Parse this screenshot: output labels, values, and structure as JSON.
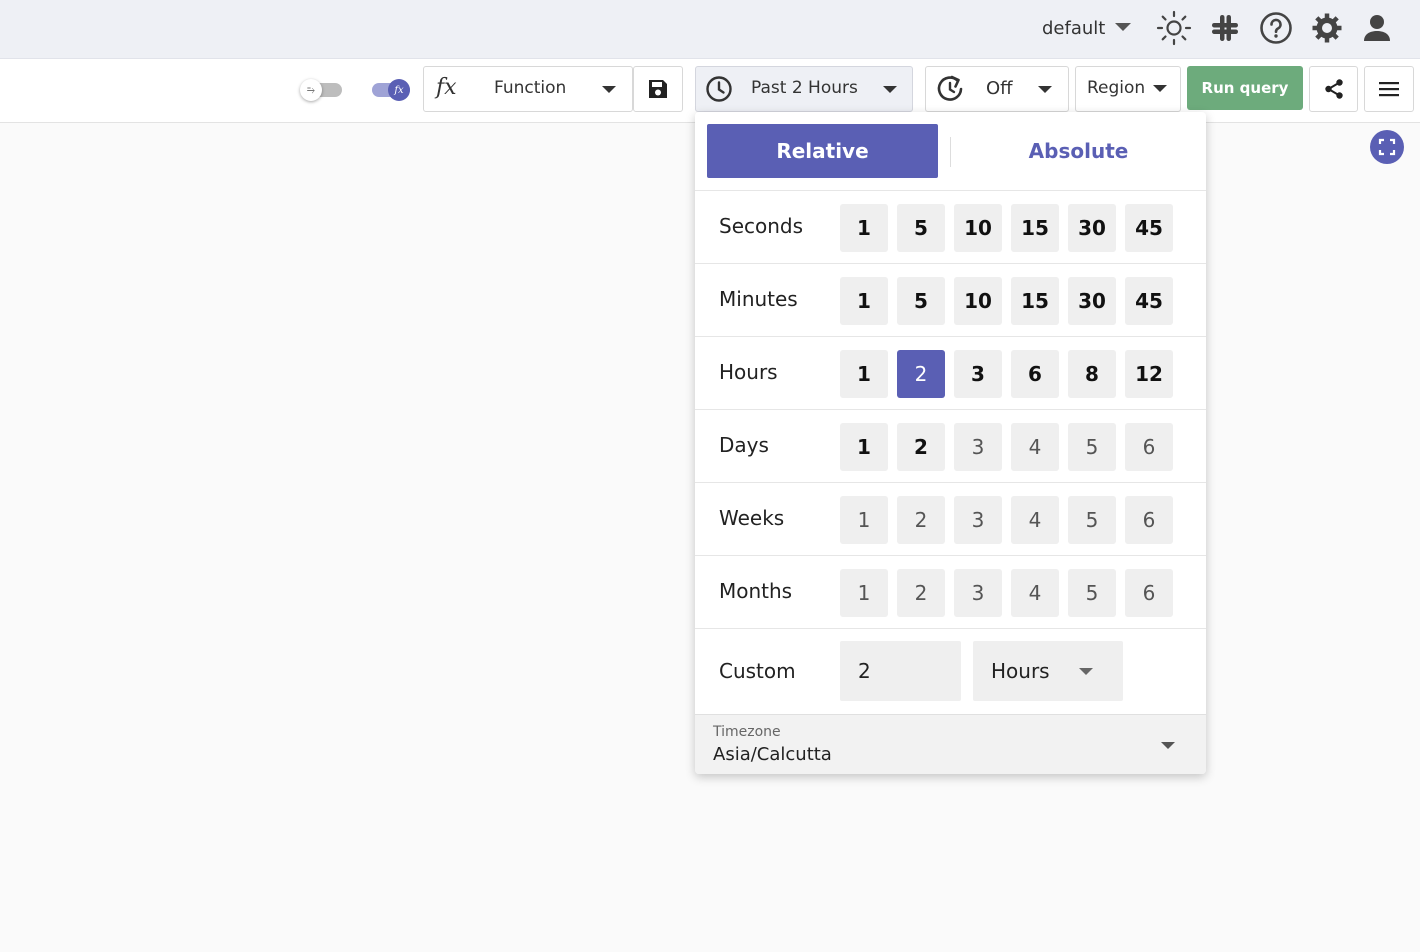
{
  "header": {
    "org_name": "default",
    "icons": [
      "theme-sun-icon",
      "slack-icon",
      "help-icon",
      "settings-gear-icon",
      "user-account-icon"
    ]
  },
  "toolbar": {
    "function_label": "Function",
    "time_range_label": "Past 2 Hours",
    "refresh_label": "Off",
    "region_label": "Region",
    "run_query_label": "Run query",
    "toggles": [
      {
        "name": "wrap-toggle",
        "on": false
      },
      {
        "name": "function-toggle",
        "on": true
      }
    ]
  },
  "time_picker": {
    "tab_relative": "Relative",
    "tab_absolute": "Absolute",
    "active_tab": "Relative",
    "rows": [
      {
        "label": "Seconds",
        "options": [
          "1",
          "5",
          "10",
          "15",
          "30",
          "45"
        ],
        "enabled": [
          true,
          true,
          true,
          true,
          true,
          true
        ],
        "selected": null
      },
      {
        "label": "Minutes",
        "options": [
          "1",
          "5",
          "10",
          "15",
          "30",
          "45"
        ],
        "enabled": [
          true,
          true,
          true,
          true,
          true,
          true
        ],
        "selected": null
      },
      {
        "label": "Hours",
        "options": [
          "1",
          "2",
          "3",
          "6",
          "8",
          "12"
        ],
        "enabled": [
          true,
          true,
          true,
          true,
          true,
          true
        ],
        "selected": "2"
      },
      {
        "label": "Days",
        "options": [
          "1",
          "2",
          "3",
          "4",
          "5",
          "6"
        ],
        "enabled": [
          true,
          true,
          false,
          false,
          false,
          false
        ],
        "selected": null
      },
      {
        "label": "Weeks",
        "options": [
          "1",
          "2",
          "3",
          "4",
          "5",
          "6"
        ],
        "enabled": [
          false,
          false,
          false,
          false,
          false,
          false
        ],
        "selected": null
      },
      {
        "label": "Months",
        "options": [
          "1",
          "2",
          "3",
          "4",
          "5",
          "6"
        ],
        "enabled": [
          false,
          false,
          false,
          false,
          false,
          false
        ],
        "selected": null
      }
    ],
    "custom": {
      "label": "Custom",
      "value": "2",
      "unit": "Hours"
    },
    "timezone": {
      "label": "Timezone",
      "value": "Asia/Calcutta"
    }
  },
  "colors": {
    "accent": "#5a5fb4",
    "run_button": "#6dab7c",
    "header_bg": "#eef0f5"
  }
}
